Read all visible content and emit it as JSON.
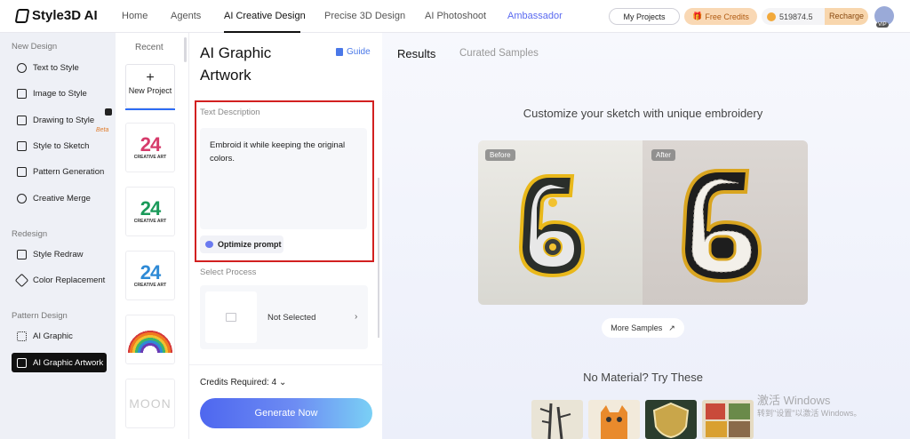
{
  "app": {
    "name": "Style3D AI"
  },
  "nav": {
    "items": [
      "Home",
      "Agents",
      "AI Creative Design",
      "Precise 3D Design",
      "AI Photoshoot",
      "Ambassador"
    ],
    "active": "AI Creative Design"
  },
  "header": {
    "my_projects": "My Projects",
    "free_credits": "Free Credits",
    "balance": "519874.5",
    "recharge": "Recharge",
    "vip": "VIP"
  },
  "sidebar": {
    "sections": [
      {
        "title": "New Design",
        "items": [
          "Text to Style",
          "Image to Style",
          "Drawing to Style",
          "Style to Sketch",
          "Pattern Generation",
          "Creative Merge"
        ]
      },
      {
        "title": "Redesign",
        "items": [
          "Style Redraw",
          "Color Replacement"
        ]
      },
      {
        "title": "Pattern Design",
        "items": [
          "AI Graphic",
          "AI Graphic Artwork"
        ]
      }
    ],
    "beta_label": "Beta",
    "active_item": "AI Graphic Artwork"
  },
  "recent": {
    "title": "Recent",
    "new_project": "New Project",
    "thumb_text": {
      "number": "24",
      "caption": "CREATIVE ART",
      "moon": "MOON"
    }
  },
  "panel": {
    "title": "AI Graphic Artwork",
    "guide": "Guide",
    "text_description_label": "Text Description",
    "text_description_value": "Embroid it while keeping the original colors.",
    "optimize_prompt": "Optimize prompt",
    "select_process_label": "Select Process",
    "process_value": "Not Selected",
    "credits_required": "Credits Required: 4",
    "generate": "Generate Now"
  },
  "main": {
    "tabs": [
      "Results",
      "Curated Samples"
    ],
    "active_tab": "Results",
    "hero_title": "Customize your sketch with unique embroidery",
    "before_label": "Before",
    "after_label": "After",
    "more_samples": "More Samples",
    "no_material": "No Material? Try These"
  },
  "os_watermark": {
    "line1": "激活 Windows",
    "line2": "转到\"设置\"以激活 Windows。"
  },
  "colors": {
    "accent": "#4e67ef",
    "highlight_box": "#d22020",
    "sidebar_bg": "#eef0f6"
  }
}
